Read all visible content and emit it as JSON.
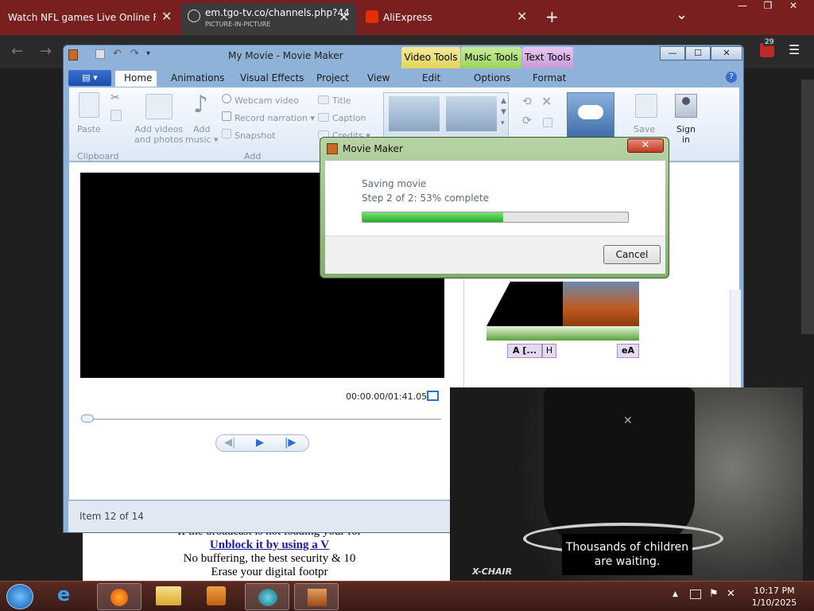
{
  "browser": {
    "tabs": [
      {
        "title": "Watch NFL games Live Online Free",
        "close": "✕"
      },
      {
        "title": "em.tgo-tv.co/channels.php?44",
        "subtitle": "PICTURE-IN-PICTURE",
        "close": "✕"
      },
      {
        "title": "AliExpress",
        "close": "✕"
      }
    ],
    "new_tab": "+",
    "tab_menu": "⌄",
    "badge_count": "29",
    "window_buttons": {
      "minimize": "—",
      "restore": "❐",
      "close": "✕"
    }
  },
  "webpage": {
    "lines": [
      "If the broadcast is not loading your for",
      "Unblock it by using a V",
      "No buffering, the best security & 10",
      "Erase your digital footpr"
    ]
  },
  "moviemaker": {
    "title": "My Movie - Movie Maker",
    "contextual_tabs": [
      "Video Tools",
      "Music Tools",
      "Text Tools"
    ],
    "ribbon_tabs": [
      "Home",
      "Animations",
      "Visual Effects",
      "Project",
      "View",
      "Edit",
      "Options",
      "Format"
    ],
    "ribbon": {
      "paste": "Paste",
      "clipboard": "Clipboard",
      "add_videos": [
        "Add videos",
        "and photos"
      ],
      "add_music": [
        "Add",
        "music ▾"
      ],
      "webcam": "Webcam video",
      "narration": "Record narration ▾",
      "snapshot": "Snapshot",
      "add_group": "Add",
      "title": "Title",
      "caption": "Caption",
      "credits": "Credits ▾",
      "save": "Save",
      "sign_in": [
        "Sign",
        "in"
      ]
    },
    "timecode": "00:00.00/01:41.05",
    "status": "Item 12 of 14",
    "storyboard_labels": [
      "A [...",
      "H",
      "eA"
    ]
  },
  "dialog": {
    "title": "Movie Maker",
    "line1": "Saving movie",
    "line2": "Step 2 of 2: 53% complete",
    "progress": 0.53,
    "cancel": "Cancel",
    "close": "✕"
  },
  "pip": {
    "caption": [
      "Thousands of children",
      "are waiting."
    ],
    "brand": "X-CHAIR"
  },
  "taskbar": {
    "time": "10:17 PM",
    "date": "1/10/2025"
  }
}
